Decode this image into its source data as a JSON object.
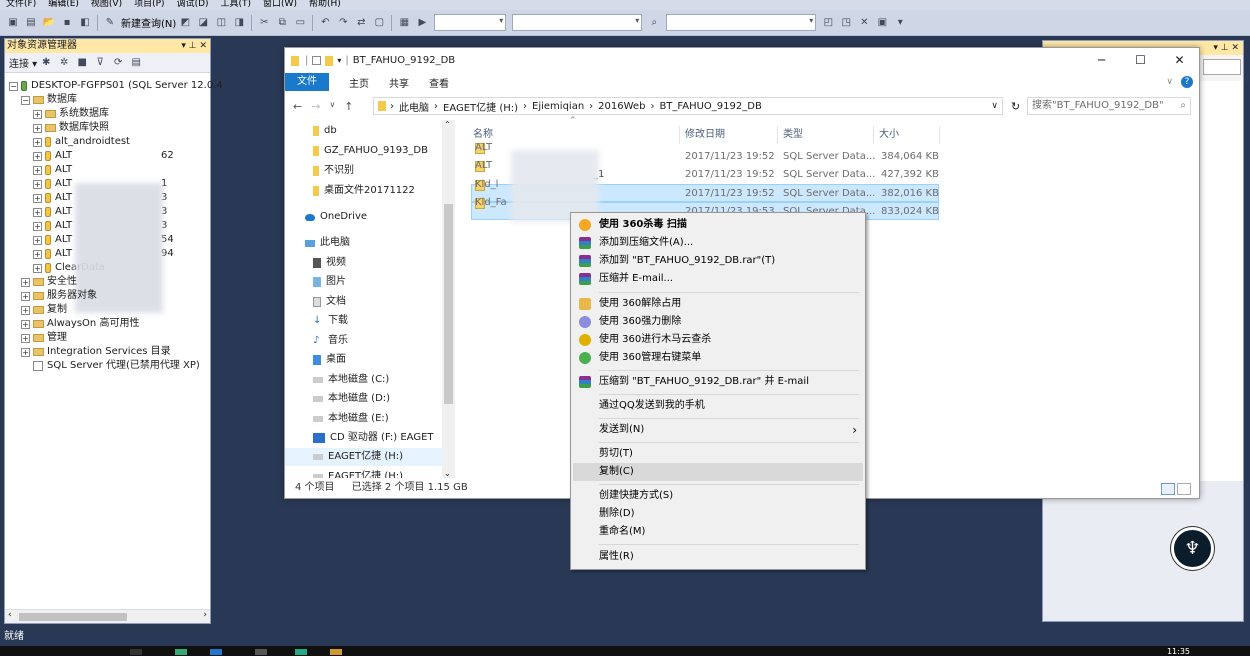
{
  "ssms": {
    "menu": [
      "文件(F)",
      "编辑(E)",
      "视图(V)",
      "项目(P)",
      "调试(D)",
      "工具(T)",
      "窗口(W)",
      "帮助(H)"
    ],
    "new_query": "新建查询(N)"
  },
  "object_explorer": {
    "title": "对象资源管理器",
    "title_controls": "▾ ⊥ ✕",
    "connect": "连接 ▾",
    "server": "DESKTOP-FGFPS01 (SQL Server 12.0.4",
    "databases": "数据库",
    "system_db": "系统数据库",
    "snapshots": "数据库快照",
    "db_list": [
      "alt_androidtest",
      "ALT",
      "ALT",
      "ALT",
      "ALT",
      "ALT",
      "ALT",
      "ALT",
      "ALT",
      "ALT",
      "ClearData"
    ],
    "db_suffixes": [
      "62",
      "",
      "1",
      "3",
      "3",
      "3",
      "54",
      "94"
    ],
    "nodes": [
      "安全性",
      "服务器对象",
      "复制",
      "AlwaysOn 高可用性",
      "管理",
      "Integration Services 目录"
    ],
    "agent": "SQL Server 代理(已禁用代理 XP)"
  },
  "explorer": {
    "title": "BT_FAHUO_9192_DB",
    "ribbon_tabs": [
      "文件",
      "主页",
      "共享",
      "查看"
    ],
    "breadcrumb": [
      "此电脑",
      "EAGET亿捷 (H:)",
      "Ejiemiqian",
      "2016Web",
      "BT_FAHUO_9192_DB"
    ],
    "search_placeholder": "搜索\"BT_FAHUO_9192_DB\"",
    "nav_items": [
      "db",
      "GZ_FAHUO_9193_DB",
      "不识别",
      "桌面文件20171122",
      "OneDrive",
      "此电脑",
      "视频",
      "图片",
      "文档",
      "下载",
      "音乐",
      "桌面",
      "本地磁盘 (C:)",
      "本地磁盘 (D:)",
      "本地磁盘 (E:)",
      "CD 驱动器 (F:) EAGET",
      "EAGET亿捷 (H:)",
      "EAGET亿捷 (H:)"
    ],
    "columns": [
      "名称",
      "修改日期",
      "类型",
      "大小"
    ],
    "files": [
      {
        "name": "ALT",
        "suffix": "",
        "date": "2017/11/23 19:52",
        "type": "SQL Server Data...",
        "size": "384,064 KB"
      },
      {
        "name": "ALT",
        "suffix": "_1",
        "date": "2017/11/23 19:52",
        "type": "SQL Server Data...",
        "size": "427,392 KB"
      },
      {
        "name": "Kld_l",
        "suffix": "",
        "date": "2017/11/23 19:52",
        "type": "SQL Server Data...",
        "size": "382,016 KB"
      },
      {
        "name": "Kld_Fa",
        "suffix": "",
        "date": "2017/11/23 19:53",
        "type": "SQL Server Data...",
        "size": "833,024 KB"
      }
    ],
    "status_count": "4 个项目",
    "status_selected": "已选择 2 个项目  1.15 GB"
  },
  "context_menu": {
    "items": [
      "使用 360杀毒 扫描",
      "添加到压缩文件(A)...",
      "添加到 \"BT_FAHUO_9192_DB.rar\"(T)",
      "压缩并 E-mail...",
      "使用 360解除占用",
      "使用 360强力删除",
      "使用 360进行木马云查杀",
      "使用 360管理右键菜单",
      "压缩到 \"BT_FAHUO_9192_DB.rar\" 并 E-mail",
      "通过QQ发送到我的手机",
      "发送到(N)",
      "剪切(T)",
      "复制(C)",
      "创建快捷方式(S)",
      "删除(D)",
      "重命名(M)",
      "属性(R)"
    ]
  },
  "status_bar": "就绪",
  "clock": "11:35",
  "colors": {
    "accent": "#1979ca",
    "selection": "#cce8ff",
    "ssms_bg": "#293955"
  }
}
